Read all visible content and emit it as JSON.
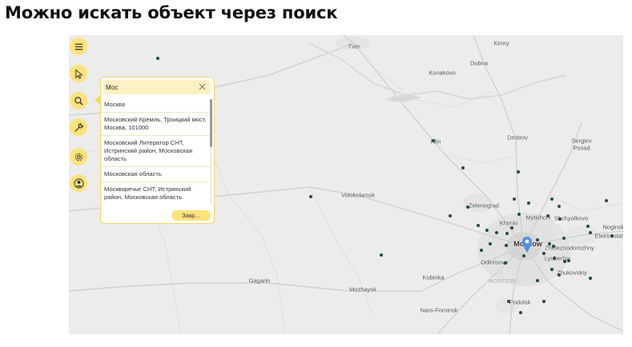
{
  "heading": "Можно искать объект через поиск",
  "toolbar": {
    "tools": [
      {
        "name": "menu-button",
        "icon": "menu-icon"
      },
      {
        "name": "select-button",
        "icon": "cursor-icon"
      },
      {
        "name": "search-button",
        "icon": "search-icon"
      },
      {
        "name": "tools-button",
        "icon": "wrench-icon"
      },
      {
        "name": "settings-button",
        "icon": "gear-icon"
      },
      {
        "name": "profile-button",
        "icon": "user-icon"
      }
    ],
    "color": "#fde37a"
  },
  "search": {
    "value": "Мос",
    "results": [
      "Москва",
      "Московский Кремль, Троицкий мост, Москва, 101000",
      "Московский Литератор СНТ, Истринский район, Московская область",
      "Московская область",
      "Москворечье СНТ, Истринский район, Московская область"
    ],
    "close_label": "Закр..."
  },
  "map": {
    "places": {
      "tver": "Tver",
      "kimry": "Kimry",
      "dubna": "Dubna",
      "konakovo": "Konakovo",
      "klin": "Klin",
      "dmitrov": "Dmitrov",
      "sergiev_posad": "Sergiev Posad",
      "volokolamsk": "Volokolamsk",
      "zelenograd": "Zelenograd",
      "khimki": "Khimki",
      "mytishchi": "Mytishchi",
      "shchyolkovo": "Shchyolkovo",
      "noginsk": "Noginsk",
      "elektrostal": "Elektrostal",
      "moscow": "Moscow",
      "zheleznodorozhny": "Zheleznodorozhny",
      "odintsovo": "Odintsovo",
      "lyubertsy": "Lyubertsy",
      "zhukovsky": "Zhukovskiy",
      "gagarin": "Gagarin",
      "kubinka": "Kubinka",
      "mozhaysk": "Mozhaysk",
      "moscow_region": "MOSCOW",
      "naro_fominsk": "Naro-Fominsk",
      "podolsk": "Podolsk"
    },
    "marker_color": "#1f4d3a",
    "pin_color": "#4f8fe0"
  }
}
